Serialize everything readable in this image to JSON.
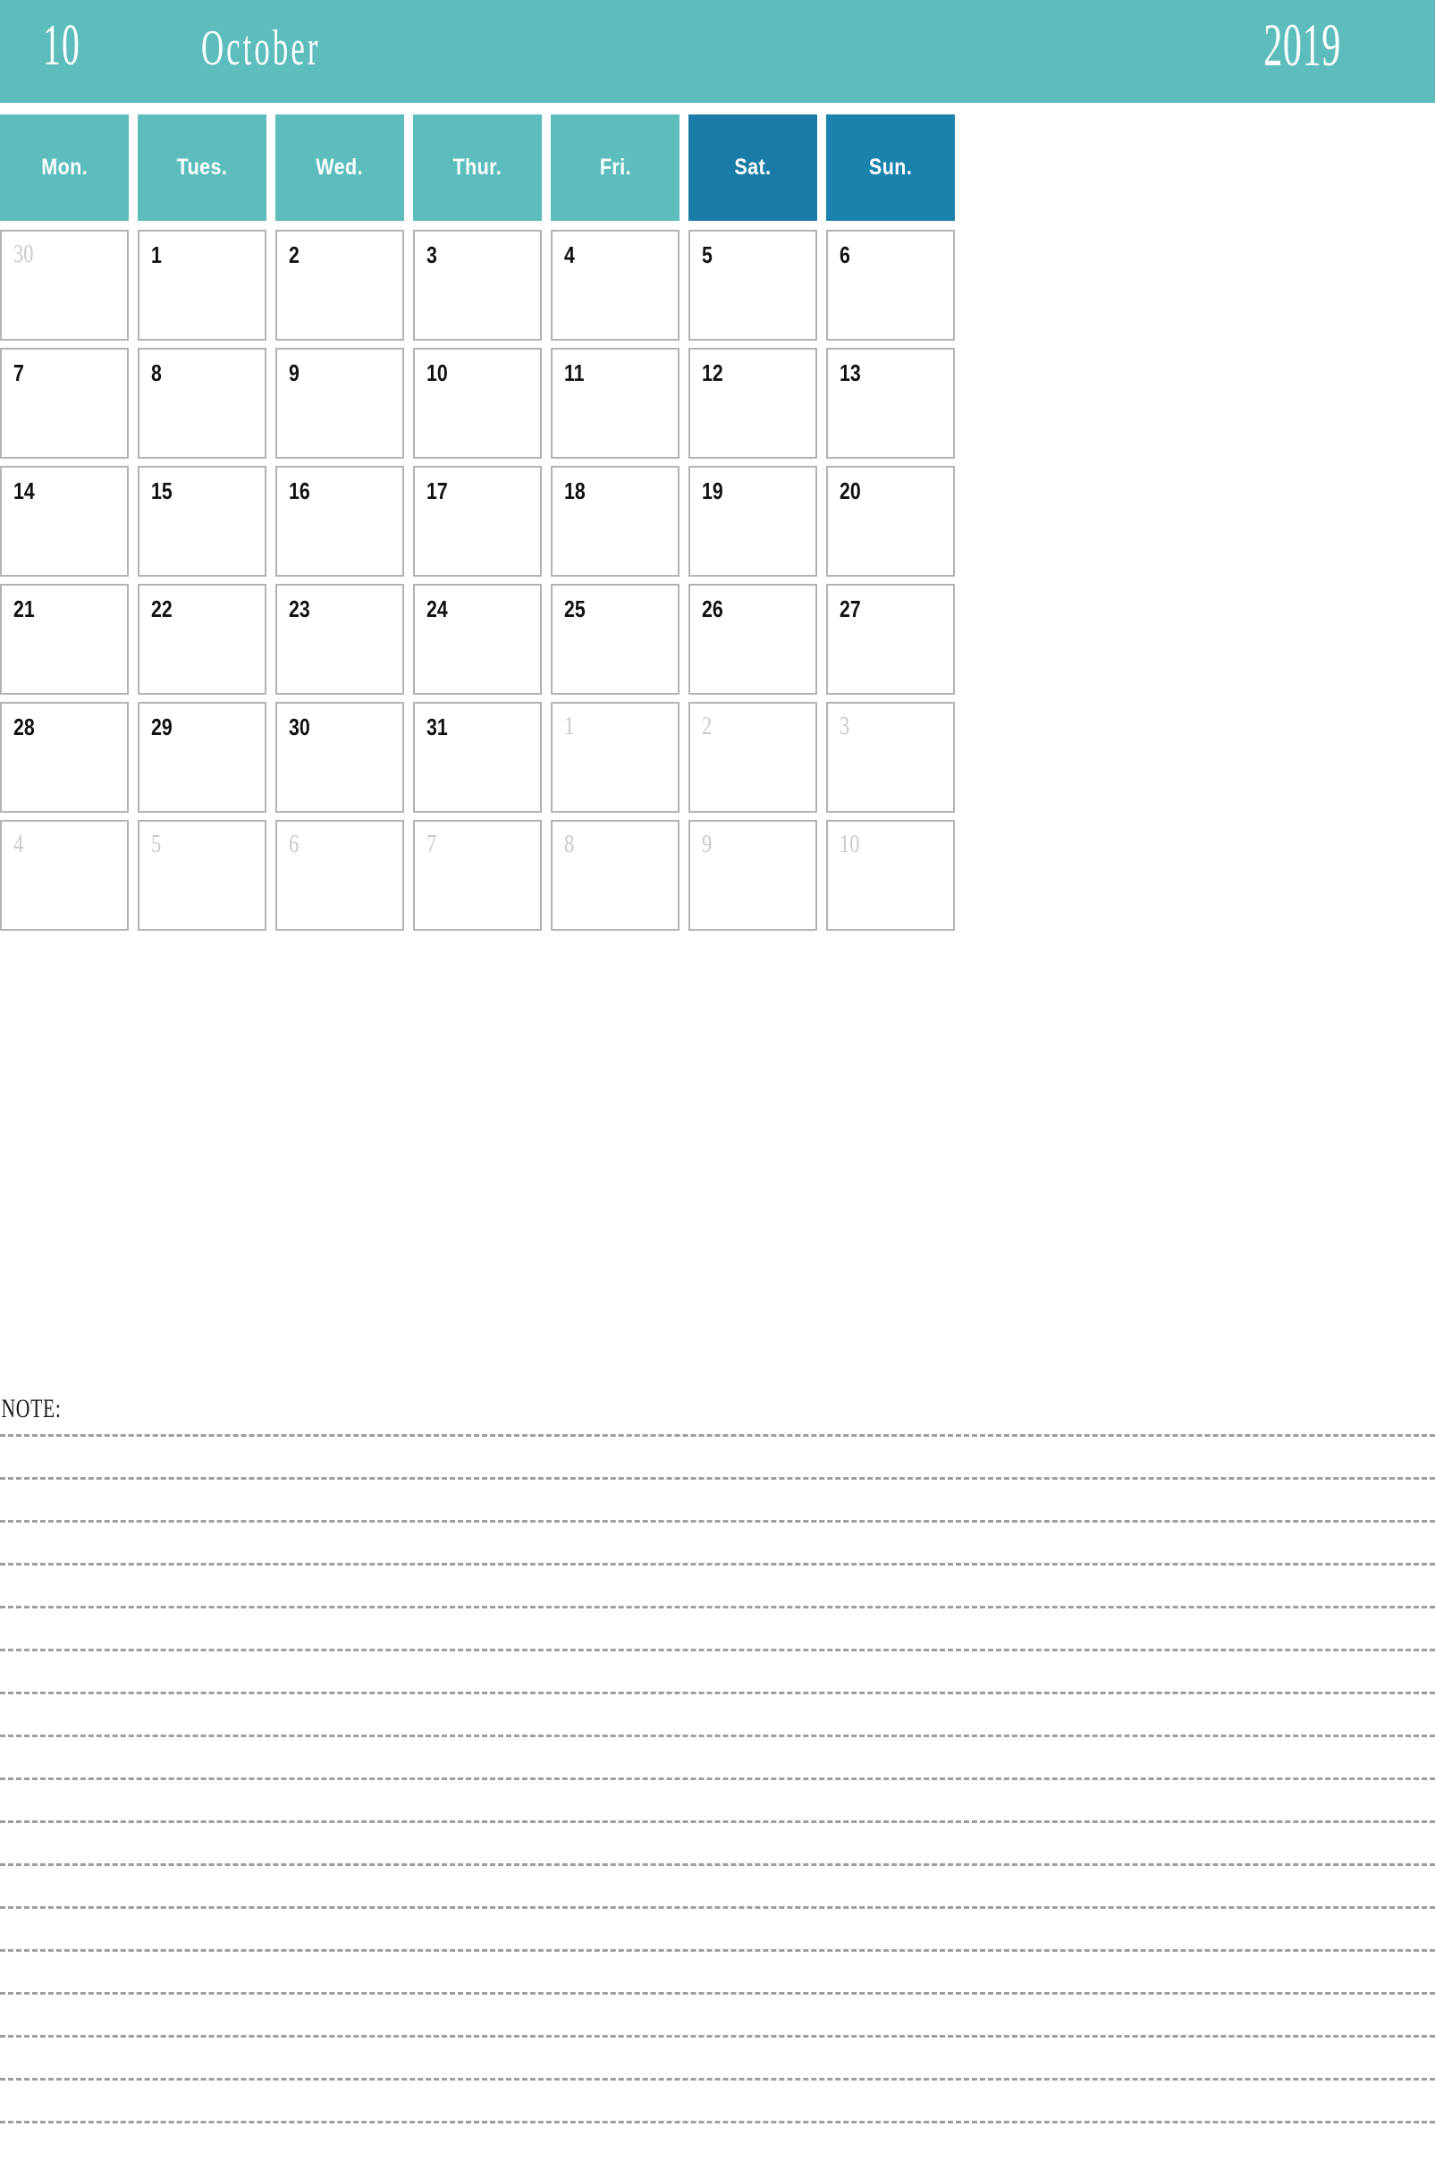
{
  "banner": {
    "month_number": "10",
    "month_name": "October",
    "year": "2019",
    "bg_color": "#5dbdbd",
    "text_color": "#ffffff"
  },
  "colors": {
    "weekday_header": "#5dbdbd",
    "saturday_header": "#1a7ba6",
    "sunday_header": "#1b82ac",
    "cell_border": "#b3b3b3",
    "current_month_text": "#111111",
    "other_month_text": "#c9c9c9",
    "note_line": "#9e9e9e"
  },
  "day_headers": [
    {
      "label": "Mon.",
      "type": "weekday"
    },
    {
      "label": "Tues.",
      "type": "weekday"
    },
    {
      "label": "Wed.",
      "type": "weekday"
    },
    {
      "label": "Thur.",
      "type": "weekday"
    },
    {
      "label": "Fri.",
      "type": "weekday"
    },
    {
      "label": "Sat.",
      "type": "saturday"
    },
    {
      "label": "Sun.",
      "type": "sunday"
    }
  ],
  "weeks": [
    [
      {
        "day": "30",
        "current_month": false
      },
      {
        "day": "1",
        "current_month": true
      },
      {
        "day": "2",
        "current_month": true
      },
      {
        "day": "3",
        "current_month": true
      },
      {
        "day": "4",
        "current_month": true
      },
      {
        "day": "5",
        "current_month": true
      },
      {
        "day": "6",
        "current_month": true
      }
    ],
    [
      {
        "day": "7",
        "current_month": true
      },
      {
        "day": "8",
        "current_month": true
      },
      {
        "day": "9",
        "current_month": true
      },
      {
        "day": "10",
        "current_month": true
      },
      {
        "day": "11",
        "current_month": true
      },
      {
        "day": "12",
        "current_month": true
      },
      {
        "day": "13",
        "current_month": true
      }
    ],
    [
      {
        "day": "14",
        "current_month": true
      },
      {
        "day": "15",
        "current_month": true
      },
      {
        "day": "16",
        "current_month": true
      },
      {
        "day": "17",
        "current_month": true
      },
      {
        "day": "18",
        "current_month": true
      },
      {
        "day": "19",
        "current_month": true
      },
      {
        "day": "20",
        "current_month": true
      }
    ],
    [
      {
        "day": "21",
        "current_month": true
      },
      {
        "day": "22",
        "current_month": true
      },
      {
        "day": "23",
        "current_month": true
      },
      {
        "day": "24",
        "current_month": true
      },
      {
        "day": "25",
        "current_month": true
      },
      {
        "day": "26",
        "current_month": true
      },
      {
        "day": "27",
        "current_month": true
      }
    ],
    [
      {
        "day": "28",
        "current_month": true
      },
      {
        "day": "29",
        "current_month": true
      },
      {
        "day": "30",
        "current_month": true
      },
      {
        "day": "31",
        "current_month": true
      },
      {
        "day": "1",
        "current_month": false
      },
      {
        "day": "2",
        "current_month": false
      },
      {
        "day": "3",
        "current_month": false
      }
    ],
    [
      {
        "day": "4",
        "current_month": false
      },
      {
        "day": "5",
        "current_month": false
      },
      {
        "day": "6",
        "current_month": false
      },
      {
        "day": "7",
        "current_month": false
      },
      {
        "day": "8",
        "current_month": false
      },
      {
        "day": "9",
        "current_month": false
      },
      {
        "day": "10",
        "current_month": false
      }
    ]
  ],
  "note": {
    "label": "NOTE:",
    "line_count": 17
  }
}
